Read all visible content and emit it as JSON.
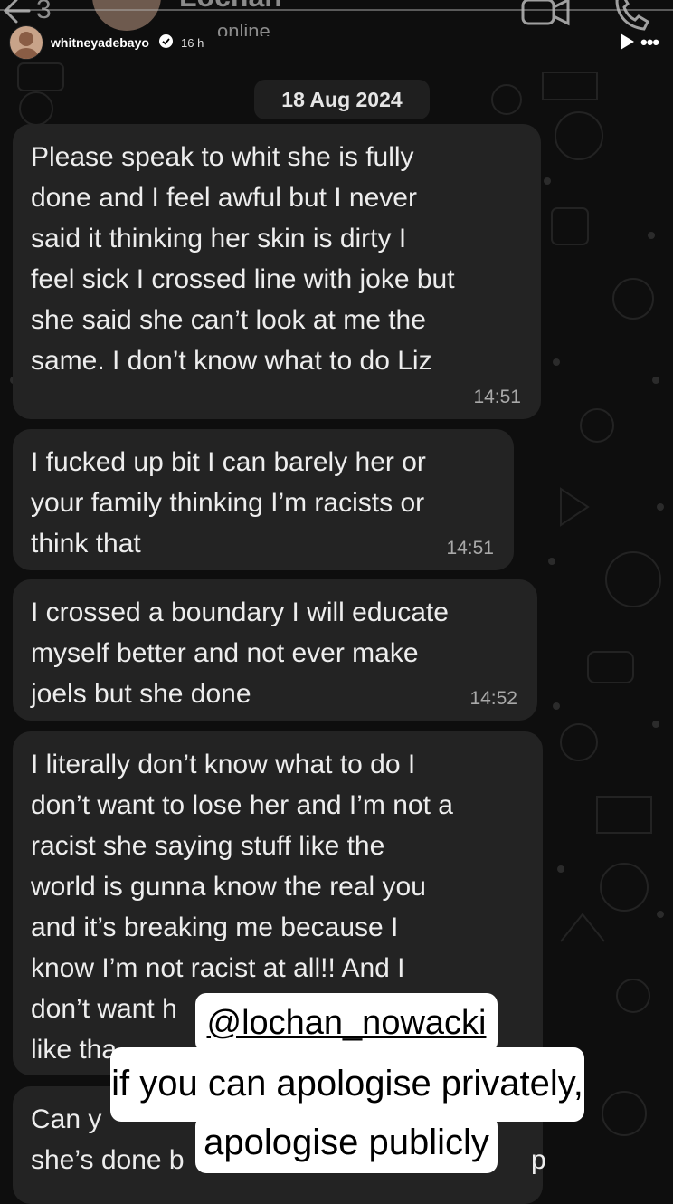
{
  "wa_header": {
    "unread_count": "3",
    "contact_name": "Lochan",
    "contact_status": "online"
  },
  "story": {
    "username": "whitneyadebayo",
    "posted_ago": "16 h",
    "play_icon": "play-icon",
    "more_icon": "more-icon",
    "more_glyph": "•••"
  },
  "chat": {
    "date": "18 Aug 2024",
    "messages": [
      {
        "text": "Please speak to whit she is fully\ndone and I feel awful but I never\nsaid it thinking her skin is dirty I\nfeel sick I crossed line with joke but\nshe said she can’t look at me the\nsame. I don’t know what to do Liz",
        "time": "14:51"
      },
      {
        "text": "I fucked up bit I can barely her or\nyour family thinking I’m racists or\nthink that",
        "time": "14:51"
      },
      {
        "text": "I crossed a boundary I will educate\nmyself better and not ever make\njoels but she done",
        "time": "14:52"
      },
      {
        "text": "I literally don’t know what to do I\ndon’t want to lose her and I’m not a\nracist she saying stuff like the\nworld is gunna know the real you\nand it’s breaking me because I\nknow I’m not racist at all!! And I\ndon’t want h                        of\nlike tha",
        "time": ""
      },
      {
        "text": "Can y\nshe’s done b                                              p",
        "time": ""
      }
    ]
  },
  "sticker": {
    "mention": "@lochan_nowacki",
    "line1": "if you can apologise privately,",
    "line2": "apologise publicly"
  }
}
